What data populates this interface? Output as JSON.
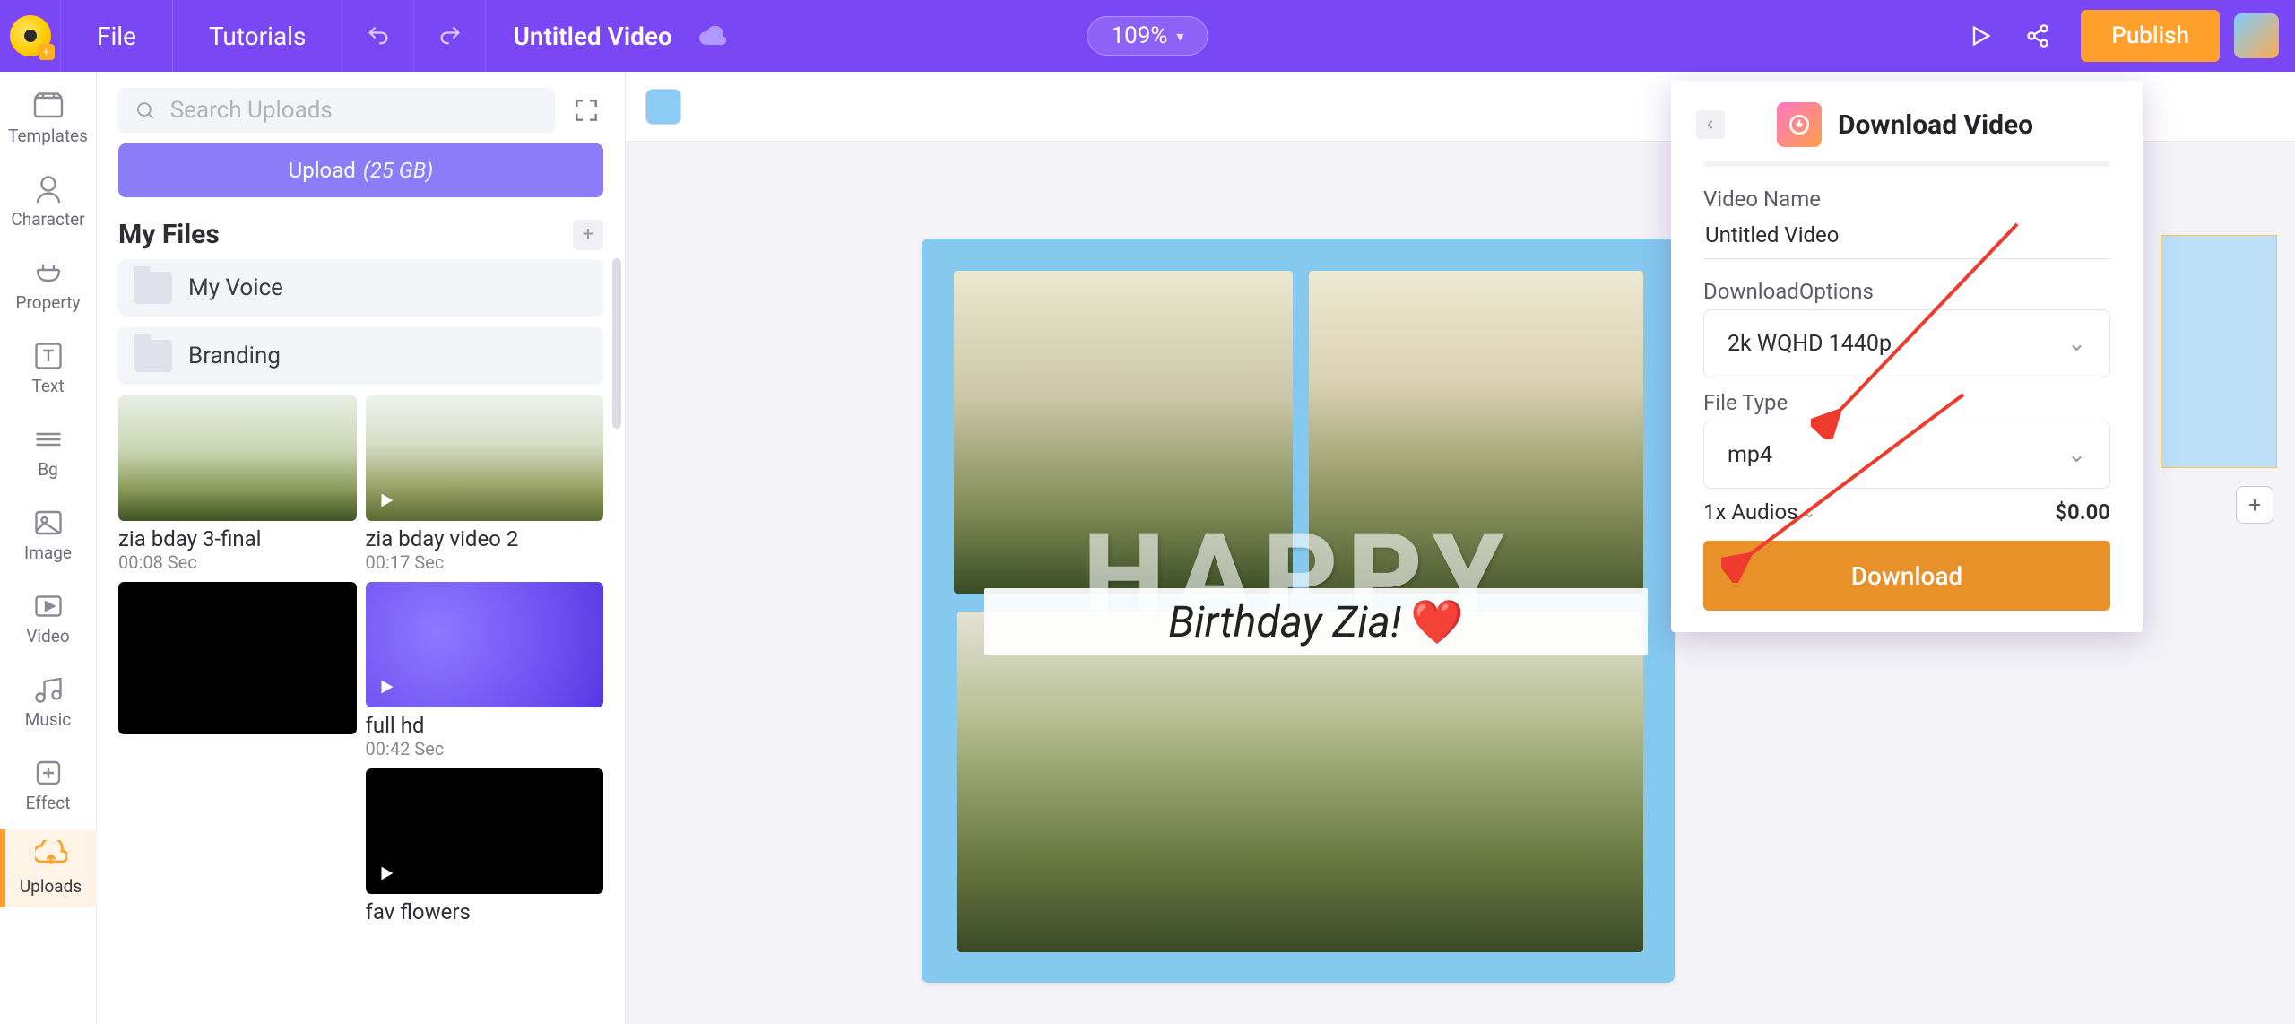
{
  "topbar": {
    "file": "File",
    "tutorials": "Tutorials",
    "title": "Untitled Video",
    "zoom": "109%",
    "publish": "Publish"
  },
  "rail": {
    "templates": "Templates",
    "character": "Character",
    "property": "Property",
    "text": "Text",
    "bg": "Bg",
    "image": "Image",
    "video": "Video",
    "music": "Music",
    "effect": "Effect",
    "uploads": "Uploads"
  },
  "sidepanel": {
    "search_placeholder": "Search Uploads",
    "upload_label": "Upload",
    "upload_quota": "(25 GB)",
    "section": "My Files",
    "folders": {
      "voice": "My Voice",
      "branding": "Branding"
    },
    "files": [
      {
        "name": "zia bday 3-final",
        "dur": "00:08 Sec"
      },
      {
        "name": "zia bday video 2",
        "dur": "00:17 Sec"
      },
      {
        "name": "",
        "dur": ""
      },
      {
        "name": "full hd",
        "dur": "00:42 Sec"
      },
      {
        "name": "",
        "dur": ""
      },
      {
        "name": "fav flowers",
        "dur": ""
      }
    ]
  },
  "stage": {
    "big_text": "HAPPY",
    "strip_text": "Birthday Zia!"
  },
  "modal": {
    "title": "Download Video",
    "video_name_label": "Video Name",
    "video_name_value": "Untitled Video",
    "download_options_label": "DownloadOptions",
    "download_options_value": "2k WQHD 1440p",
    "file_type_label": "File Type",
    "file_type_value": "mp4",
    "audios_label": "1x Audios",
    "price": "$0.00",
    "download_cta": "Download"
  }
}
